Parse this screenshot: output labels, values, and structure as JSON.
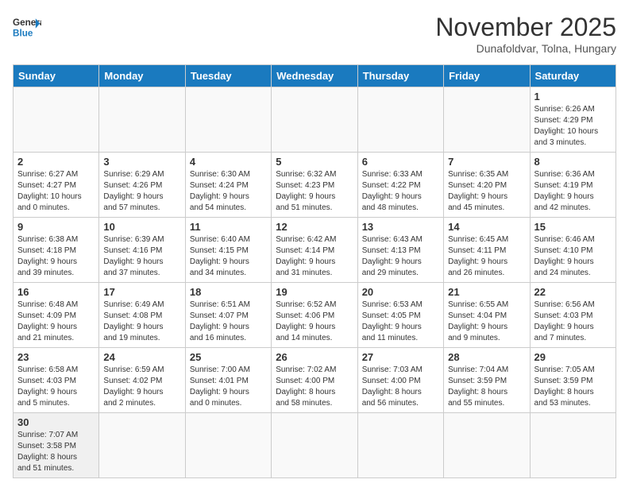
{
  "header": {
    "logo_line1": "General",
    "logo_line2": "Blue",
    "month": "November 2025",
    "location": "Dunafoldvar, Tolna, Hungary"
  },
  "weekdays": [
    "Sunday",
    "Monday",
    "Tuesday",
    "Wednesday",
    "Thursday",
    "Friday",
    "Saturday"
  ],
  "weeks": [
    [
      {
        "day": "",
        "info": ""
      },
      {
        "day": "",
        "info": ""
      },
      {
        "day": "",
        "info": ""
      },
      {
        "day": "",
        "info": ""
      },
      {
        "day": "",
        "info": ""
      },
      {
        "day": "",
        "info": ""
      },
      {
        "day": "1",
        "info": "Sunrise: 6:26 AM\nSunset: 4:29 PM\nDaylight: 10 hours\nand 3 minutes."
      }
    ],
    [
      {
        "day": "2",
        "info": "Sunrise: 6:27 AM\nSunset: 4:27 PM\nDaylight: 10 hours\nand 0 minutes."
      },
      {
        "day": "3",
        "info": "Sunrise: 6:29 AM\nSunset: 4:26 PM\nDaylight: 9 hours\nand 57 minutes."
      },
      {
        "day": "4",
        "info": "Sunrise: 6:30 AM\nSunset: 4:24 PM\nDaylight: 9 hours\nand 54 minutes."
      },
      {
        "day": "5",
        "info": "Sunrise: 6:32 AM\nSunset: 4:23 PM\nDaylight: 9 hours\nand 51 minutes."
      },
      {
        "day": "6",
        "info": "Sunrise: 6:33 AM\nSunset: 4:22 PM\nDaylight: 9 hours\nand 48 minutes."
      },
      {
        "day": "7",
        "info": "Sunrise: 6:35 AM\nSunset: 4:20 PM\nDaylight: 9 hours\nand 45 minutes."
      },
      {
        "day": "8",
        "info": "Sunrise: 6:36 AM\nSunset: 4:19 PM\nDaylight: 9 hours\nand 42 minutes."
      }
    ],
    [
      {
        "day": "9",
        "info": "Sunrise: 6:38 AM\nSunset: 4:18 PM\nDaylight: 9 hours\nand 39 minutes."
      },
      {
        "day": "10",
        "info": "Sunrise: 6:39 AM\nSunset: 4:16 PM\nDaylight: 9 hours\nand 37 minutes."
      },
      {
        "day": "11",
        "info": "Sunrise: 6:40 AM\nSunset: 4:15 PM\nDaylight: 9 hours\nand 34 minutes."
      },
      {
        "day": "12",
        "info": "Sunrise: 6:42 AM\nSunset: 4:14 PM\nDaylight: 9 hours\nand 31 minutes."
      },
      {
        "day": "13",
        "info": "Sunrise: 6:43 AM\nSunset: 4:13 PM\nDaylight: 9 hours\nand 29 minutes."
      },
      {
        "day": "14",
        "info": "Sunrise: 6:45 AM\nSunset: 4:11 PM\nDaylight: 9 hours\nand 26 minutes."
      },
      {
        "day": "15",
        "info": "Sunrise: 6:46 AM\nSunset: 4:10 PM\nDaylight: 9 hours\nand 24 minutes."
      }
    ],
    [
      {
        "day": "16",
        "info": "Sunrise: 6:48 AM\nSunset: 4:09 PM\nDaylight: 9 hours\nand 21 minutes."
      },
      {
        "day": "17",
        "info": "Sunrise: 6:49 AM\nSunset: 4:08 PM\nDaylight: 9 hours\nand 19 minutes."
      },
      {
        "day": "18",
        "info": "Sunrise: 6:51 AM\nSunset: 4:07 PM\nDaylight: 9 hours\nand 16 minutes."
      },
      {
        "day": "19",
        "info": "Sunrise: 6:52 AM\nSunset: 4:06 PM\nDaylight: 9 hours\nand 14 minutes."
      },
      {
        "day": "20",
        "info": "Sunrise: 6:53 AM\nSunset: 4:05 PM\nDaylight: 9 hours\nand 11 minutes."
      },
      {
        "day": "21",
        "info": "Sunrise: 6:55 AM\nSunset: 4:04 PM\nDaylight: 9 hours\nand 9 minutes."
      },
      {
        "day": "22",
        "info": "Sunrise: 6:56 AM\nSunset: 4:03 PM\nDaylight: 9 hours\nand 7 minutes."
      }
    ],
    [
      {
        "day": "23",
        "info": "Sunrise: 6:58 AM\nSunset: 4:03 PM\nDaylight: 9 hours\nand 5 minutes."
      },
      {
        "day": "24",
        "info": "Sunrise: 6:59 AM\nSunset: 4:02 PM\nDaylight: 9 hours\nand 2 minutes."
      },
      {
        "day": "25",
        "info": "Sunrise: 7:00 AM\nSunset: 4:01 PM\nDaylight: 9 hours\nand 0 minutes."
      },
      {
        "day": "26",
        "info": "Sunrise: 7:02 AM\nSunset: 4:00 PM\nDaylight: 8 hours\nand 58 minutes."
      },
      {
        "day": "27",
        "info": "Sunrise: 7:03 AM\nSunset: 4:00 PM\nDaylight: 8 hours\nand 56 minutes."
      },
      {
        "day": "28",
        "info": "Sunrise: 7:04 AM\nSunset: 3:59 PM\nDaylight: 8 hours\nand 55 minutes."
      },
      {
        "day": "29",
        "info": "Sunrise: 7:05 AM\nSunset: 3:59 PM\nDaylight: 8 hours\nand 53 minutes."
      }
    ],
    [
      {
        "day": "30",
        "info": "Sunrise: 7:07 AM\nSunset: 3:58 PM\nDaylight: 8 hours\nand 51 minutes."
      },
      {
        "day": "",
        "info": ""
      },
      {
        "day": "",
        "info": ""
      },
      {
        "day": "",
        "info": ""
      },
      {
        "day": "",
        "info": ""
      },
      {
        "day": "",
        "info": ""
      },
      {
        "day": "",
        "info": ""
      }
    ]
  ]
}
